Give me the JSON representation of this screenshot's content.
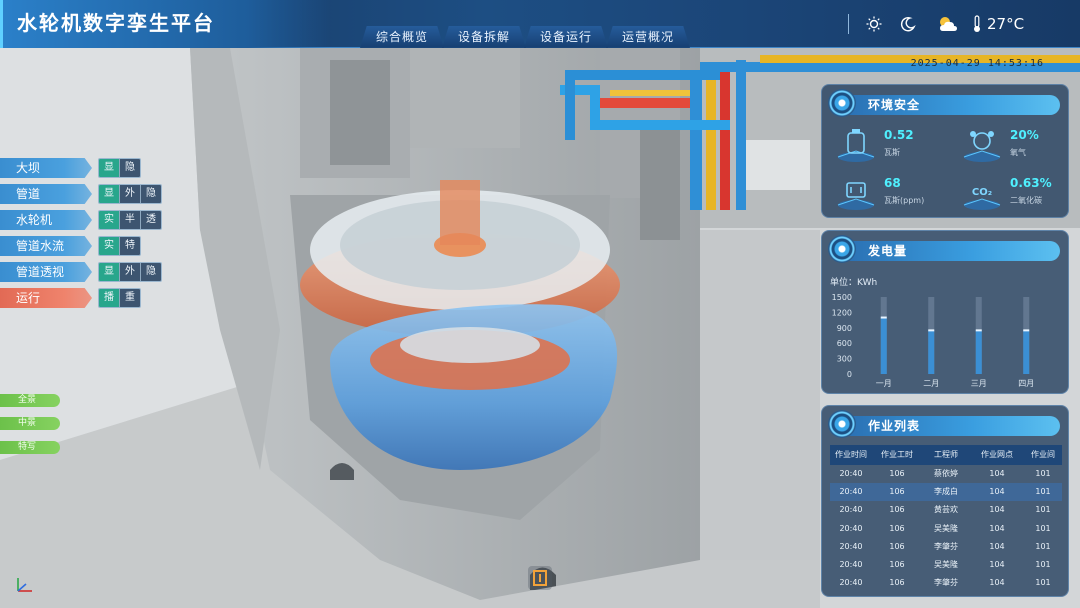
{
  "app": {
    "title": "水轮机数字孪生平台"
  },
  "nav": {
    "items": [
      "综合概览",
      "设备拆解",
      "设备运行",
      "运营概况"
    ]
  },
  "header": {
    "icons": [
      "sun-icon",
      "moon-icon",
      "partly-cloudy-icon",
      "thermometer-icon"
    ],
    "temperature": "27°C",
    "datetime": "2025-04-29 14:53:16"
  },
  "controls": [
    {
      "label": "大坝",
      "buttons": [
        "显示",
        "隐藏"
      ],
      "active": 0
    },
    {
      "label": "管道",
      "buttons": [
        "显示",
        "外踹",
        "隐藏"
      ],
      "active": 0
    },
    {
      "label": "水轮机",
      "buttons": [
        "实体",
        "半透",
        "透明"
      ],
      "active": 0
    },
    {
      "label": "管道水流",
      "buttons": [
        "实体",
        "特效"
      ],
      "active": 0
    },
    {
      "label": "管道透视",
      "buttons": [
        "显示",
        "外踹",
        "隐藏"
      ],
      "active": 0
    },
    {
      "label": "运行",
      "buttons": [
        "播放",
        "重置"
      ],
      "active": 0
    }
  ],
  "views": [
    "全景",
    "中景",
    "特写"
  ],
  "env_panel": {
    "title": "环境安全",
    "items": [
      {
        "value": "0.52",
        "label": "瓦斯",
        "icon": "gas-tank-icon"
      },
      {
        "value": "20%",
        "label": "氧气",
        "icon": "oxygen-icon"
      },
      {
        "value": "68",
        "label": "瓦斯(ppm)",
        "icon": "gas-ppm-icon"
      },
      {
        "value": "0.63%",
        "label": "二氧化碳",
        "icon": "co2-icon"
      }
    ],
    "co2_symbol": "CO₂"
  },
  "power_panel": {
    "title": "发电量",
    "unit": "单位：KWh"
  },
  "chart_data": {
    "type": "bar",
    "categories": [
      "一月",
      "二月",
      "三月",
      "四月"
    ],
    "values": [
      1100,
      850,
      850,
      850
    ],
    "yticks": [
      0,
      300,
      600,
      900,
      1200,
      1500
    ],
    "ylim": [
      0,
      1500
    ],
    "ylabel": "",
    "xlabel": ""
  },
  "jobs_panel": {
    "title": "作业列表",
    "columns": [
      "作业时间",
      "作业工时",
      "工程师",
      "作业网点",
      "作业间"
    ],
    "rows": [
      [
        "20:40",
        "106",
        "蔡依婷",
        "104",
        "101"
      ],
      [
        "20:40",
        "106",
        "李成白",
        "104",
        "101"
      ],
      [
        "20:40",
        "106",
        "黄芸欢",
        "104",
        "101"
      ],
      [
        "20:40",
        "106",
        "吴美隆",
        "104",
        "101"
      ],
      [
        "20:40",
        "106",
        "李肇芬",
        "104",
        "101"
      ],
      [
        "20:40",
        "106",
        "吴美隆",
        "104",
        "101"
      ],
      [
        "20:40",
        "106",
        "李肇芬",
        "104",
        "101"
      ]
    ]
  },
  "colors": {
    "accent": "#3a9ee0",
    "active_button": "#28a68c",
    "run_label": "#e26a55",
    "view_button": "#6cc14a",
    "bar": "#3b8fd4",
    "value_text": "#4ff0ff"
  }
}
